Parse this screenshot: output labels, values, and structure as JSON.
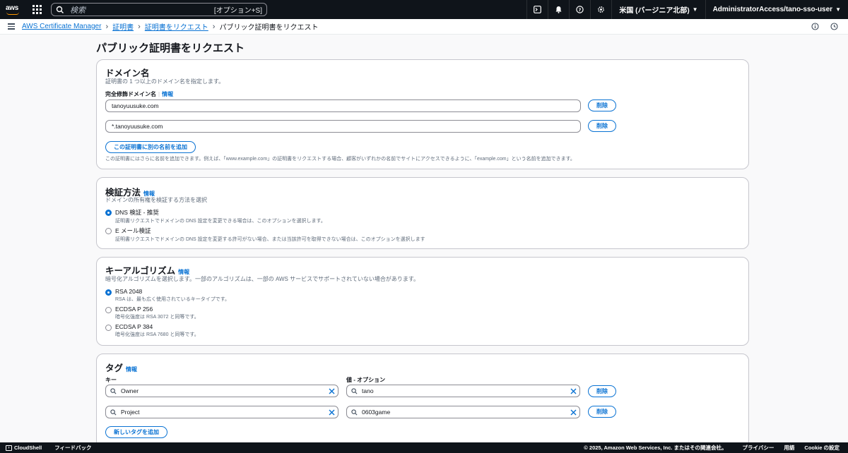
{
  "topnav": {
    "logo": "aws",
    "search_placeholder": "検索",
    "search_shortcut": "[オプション+S]",
    "region": "米国 (バージニア北部)",
    "account": "AdministratorAccess/tano-sso-user"
  },
  "breadcrumb": {
    "items": [
      "AWS Certificate Manager",
      "証明書",
      "証明書をリクエスト"
    ],
    "current": "パブリック証明書をリクエスト"
  },
  "page": {
    "title": "パブリック証明書をリクエスト"
  },
  "domain_section": {
    "title": "ドメイン名",
    "description": "証明書の 1 つ以上のドメイン名を指定します。",
    "fqdn_label": "完全修飾ドメイン名",
    "info": "情報",
    "domains": [
      "tanoyuusuke.com",
      "*.tanoyuusuke.com"
    ],
    "remove_label": "削除",
    "add_button": "この証明書に別の名前を追加",
    "hint": "この証明書にはさらに名前を追加できます。例えば、「www.example.com」の証明書をリクエストする場合、顧客がいずれかの名前でサイトにアクセスできるように、「example.com」という名前を追加できます。"
  },
  "validation_section": {
    "title": "検証方法",
    "info": "情報",
    "description": "ドメインの所有権を検証する方法を選択",
    "options": [
      {
        "label": "DNS 検証 - 推奨",
        "desc": "証明書リクエストでドメインの DNS 設定を変更できる場合は、このオプションを選択します。",
        "selected": true
      },
      {
        "label": "E メール検証",
        "desc": "証明書リクエストでドメインの DNS 設定を変更する許可がない場合、または当該許可を取得できない場合は、このオプションを選択します",
        "selected": false
      }
    ]
  },
  "key_section": {
    "title": "キーアルゴリズム",
    "info": "情報",
    "description": "暗号化アルゴリズムを選択します。一部のアルゴリズムは、一部の AWS サービスでサポートされていない場合があります。",
    "options": [
      {
        "label": "RSA 2048",
        "desc": "RSA は、最も広く使用されているキータイプです。",
        "selected": true
      },
      {
        "label": "ECDSA P 256",
        "desc": "暗号化強度は RSA 3072 と同等です。",
        "selected": false
      },
      {
        "label": "ECDSA P 384",
        "desc": "暗号化強度は RSA 7680 と同等です。",
        "selected": false
      }
    ]
  },
  "tag_section": {
    "title": "タグ",
    "info": "情報",
    "key_label": "キー",
    "value_label": "値 - オプション",
    "tags": [
      {
        "key": "Owner",
        "value": "tano"
      },
      {
        "key": "Project",
        "value": "0603game"
      }
    ],
    "remove_label": "削除",
    "add_button": "新しいタグを追加"
  },
  "footer": {
    "cloudshell": "CloudShell",
    "feedback": "フィードバック",
    "copyright": "© 2025, Amazon Web Services, Inc. またはその関連会社。",
    "privacy": "プライバシー",
    "terms": "用語",
    "cookie": "Cookie の設定"
  },
  "colors": {
    "accent": "#0972d3",
    "nav_bg": "#0f141a",
    "aws_orange": "#ff9900"
  }
}
